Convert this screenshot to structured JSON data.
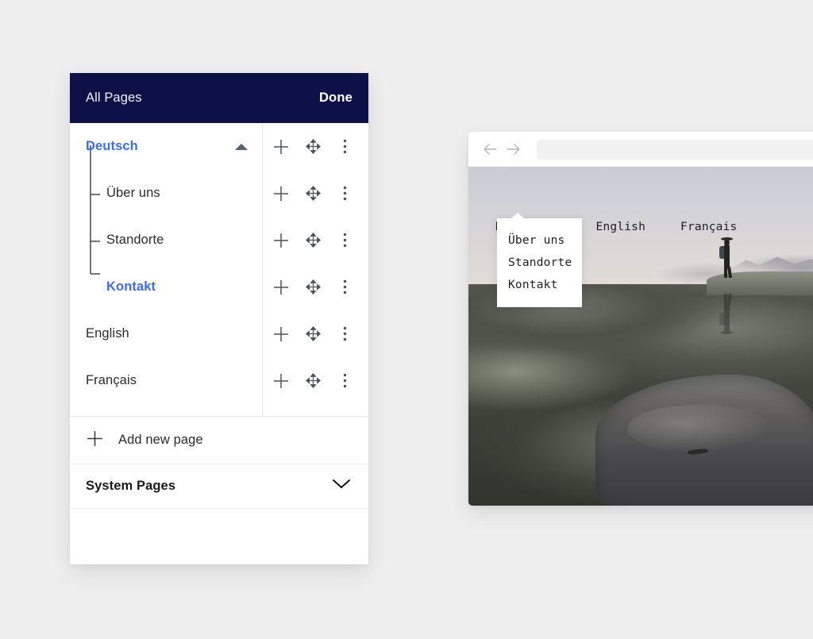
{
  "panel": {
    "header": {
      "title": "All Pages",
      "done_label": "Done"
    },
    "rows": [
      {
        "label": "Deutsch",
        "level": 0,
        "accent": true,
        "caret": "caret-up"
      },
      {
        "label": "Über uns",
        "level": 1,
        "accent": false,
        "caret": ""
      },
      {
        "label": "Standorte",
        "level": 1,
        "accent": false,
        "caret": ""
      },
      {
        "label": "Kontakt",
        "level": 1,
        "accent": true,
        "caret": ""
      },
      {
        "label": "English",
        "level": 0,
        "accent": false,
        "caret": ""
      },
      {
        "label": "Français",
        "level": 0,
        "accent": false,
        "caret": ""
      }
    ],
    "row_actions": {
      "add": "plus-icon",
      "move": "move-icon",
      "more": "more-vertical-icon"
    },
    "add_new_page": {
      "label": "Add new page",
      "icon": "plus-icon"
    },
    "system_pages": {
      "label": "System Pages",
      "icon": "chevron-down-icon"
    }
  },
  "browser": {
    "back_icon": "arrow-left-icon",
    "forward_icon": "arrow-right-icon",
    "url_value": "",
    "url_placeholder": ""
  },
  "preview": {
    "nav": [
      {
        "label": "Deutsch",
        "caret": "chevron-up-icon",
        "active": true
      },
      {
        "label": "English",
        "caret": "",
        "active": false
      },
      {
        "label": "Français",
        "caret": "",
        "active": false
      }
    ],
    "dropdown": {
      "items": [
        "Über uns",
        "Standorte",
        "Kontakt"
      ]
    },
    "photo_alt": "hiker standing on rocky summit above clouds beside reflecting pool"
  },
  "colors": {
    "header_navy": "#0d1147",
    "accent_blue": "#3b6df2",
    "page_background": "#eeeeee",
    "panel_white": "#ffffff",
    "icon_gray": "#4c5160"
  }
}
